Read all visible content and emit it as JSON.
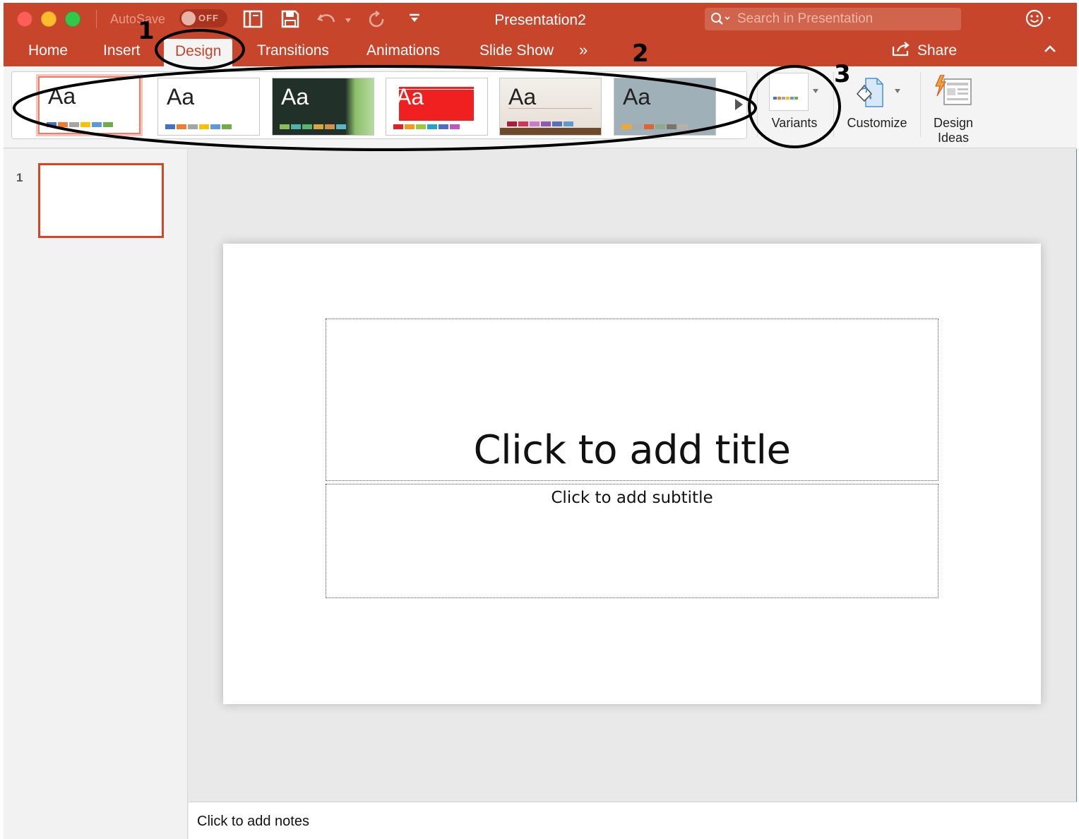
{
  "window": {
    "title": "Presentation2",
    "autosave_label": "AutoSave",
    "autosave_state": "OFF"
  },
  "search": {
    "placeholder": "Search in Presentation"
  },
  "tabs": [
    {
      "label": "Home"
    },
    {
      "label": "Insert"
    },
    {
      "label": "Design",
      "active": true
    },
    {
      "label": "Transitions"
    },
    {
      "label": "Animations"
    },
    {
      "label": "Slide Show"
    }
  ],
  "tabs_overflow": "»",
  "share_label": "Share",
  "ribbon": {
    "themes": [
      {
        "label": "Aa",
        "bg": "#ffffff",
        "fg": "#222222",
        "swatches": [
          "#4472c4",
          "#ed7d31",
          "#a5a5a5",
          "#ffc000",
          "#5b9bd5",
          "#70ad47"
        ]
      },
      {
        "label": "Aa",
        "bg": "#ffffff",
        "fg": "#222222",
        "swatches": [
          "#4472c4",
          "#ed7d31",
          "#a5a5a5",
          "#ffc000",
          "#5b9bd5",
          "#70ad47"
        ]
      },
      {
        "label": "Aa",
        "bg": "#22302a",
        "fg": "#ffffff",
        "swatches": [
          "#8cbc5a",
          "#4fb3a9",
          "#57b66b",
          "#d6a83e",
          "#d7904a",
          "#5ab7c2"
        ]
      },
      {
        "label": "Aa",
        "bg": "#ffffff",
        "fg": "#ffffff",
        "swatches": [
          "#e81e25",
          "#f39a1e",
          "#9ec93b",
          "#22a5c7",
          "#4b6fc4",
          "#c353c9"
        ]
      },
      {
        "label": "Aa",
        "bg": "#efeae4",
        "fg": "#222222",
        "swatches": [
          "#a5203e",
          "#d0365c",
          "#c97cc7",
          "#8a5bb0",
          "#5b6eb8",
          "#5e9bcc"
        ]
      },
      {
        "label": "Aa",
        "bg": "#9fb0b8",
        "fg": "#222222",
        "swatches": [
          "#f0a830",
          "#a9a9a9",
          "#e0642e",
          "#8fa98a",
          "#7d7468",
          "#b9b1a6"
        ]
      }
    ],
    "variants_label": "Variants",
    "customize_label": "Customize",
    "design_ideas_label_1": "Design",
    "design_ideas_label_2": "Ideas"
  },
  "thumbnails": [
    {
      "number": "1"
    }
  ],
  "slide": {
    "title_placeholder": "Click to add title",
    "subtitle_placeholder": "Click to add subtitle"
  },
  "notes_placeholder": "Click to add notes",
  "annotations": [
    "1",
    "2",
    "3"
  ],
  "colors": {
    "accent": "#c6452b",
    "selected_thumb_border": "#d24726"
  }
}
